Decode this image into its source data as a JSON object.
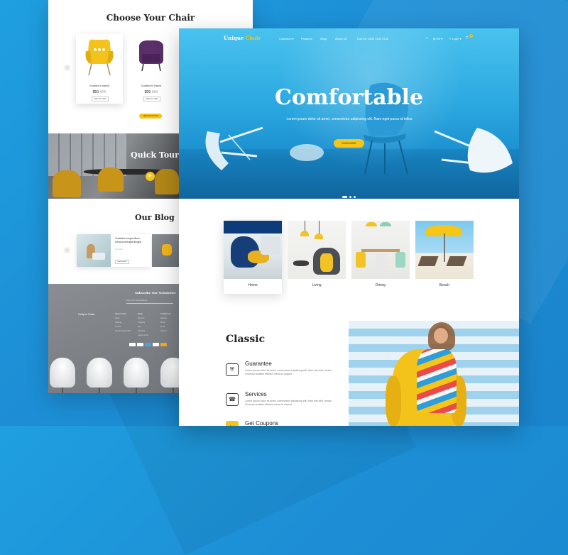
{
  "left_page": {
    "choose": {
      "title": "Choose Your Chair",
      "prev_icon": "chevron-left-icon",
      "products": [
        {
          "name": "Godalba hi mauris",
          "price": "$50",
          "old_price": "$75",
          "button": "ADD TO CART"
        },
        {
          "name": "Godalba hi mauris",
          "price": "$99",
          "old_price": "$50",
          "button": "ADD TO CART"
        }
      ],
      "view_all": "VIEW PRODUCTS"
    },
    "quick_tour": {
      "title": "Quick Tour",
      "play_icon": "play-icon"
    },
    "blog": {
      "title": "Our Blog",
      "post": {
        "title": "Vestibulum magna libero, vehicula at feugiat fringilla.",
        "date": "Jan 2019",
        "button": "READ MORE"
      }
    },
    "footer": {
      "newsletter_title": "Subscribe Our Newsletter",
      "newsletter_placeholder": "Enter Your Email Address",
      "logo": "Unique Chair",
      "col1": {
        "title": "About Links",
        "items": [
          "About",
          "Features",
          "Contact",
          "Product Testimonials"
        ]
      },
      "col2": {
        "title": "Shop",
        "items": [
          "Products",
          "Shopping",
          "Cart",
          "Checkout",
          "Coupon Code"
        ]
      },
      "col3": {
        "title": "Contact Us",
        "items": [
          "Address",
          "Phone",
          "Email",
          "Support"
        ]
      }
    }
  },
  "header": {
    "logo_main": "Unique",
    "logo_accent": "Chair",
    "menu": [
      "Collection ▾",
      "Features",
      "Shop",
      "About Us"
    ],
    "call": "Call Us: 1800 1234 2134",
    "search_icon": "search-icon",
    "lang": "EN ▾",
    "login": "Login ▾",
    "cart_icon": "cart-icon",
    "cart_count": "0"
  },
  "hero": {
    "title": "Comfortable",
    "subtitle": "Lorem ipsum dolor sit amet, consectetur adipiscing elit. Nam eget purus id tellus",
    "button": "KNOW MORE"
  },
  "categories": [
    {
      "label": "Home"
    },
    {
      "label": "Living"
    },
    {
      "label": "Dining"
    },
    {
      "label": "Beach"
    }
  ],
  "classic": {
    "title": "Classic",
    "features": [
      {
        "title": "Guarantee",
        "icon": "shield-icon",
        "desc": "Lorem ipsum dolor sit amet, consectetur adipiscing elit. Nam nisl velit, metus. Vivamus sodales efficitur metus id aliquet."
      },
      {
        "title": "Services",
        "icon": "services-icon",
        "desc": "Lorem ipsum dolor sit amet, consectetur adipiscing elit. Nam nisl velit, metus. Vivamus sodales efficitur metus id aliquet."
      },
      {
        "title": "Get Coupons",
        "icon": "coupon-icon",
        "desc": ""
      }
    ]
  },
  "colors": {
    "accent": "#f5c518",
    "primary": "#1f9fe0"
  }
}
